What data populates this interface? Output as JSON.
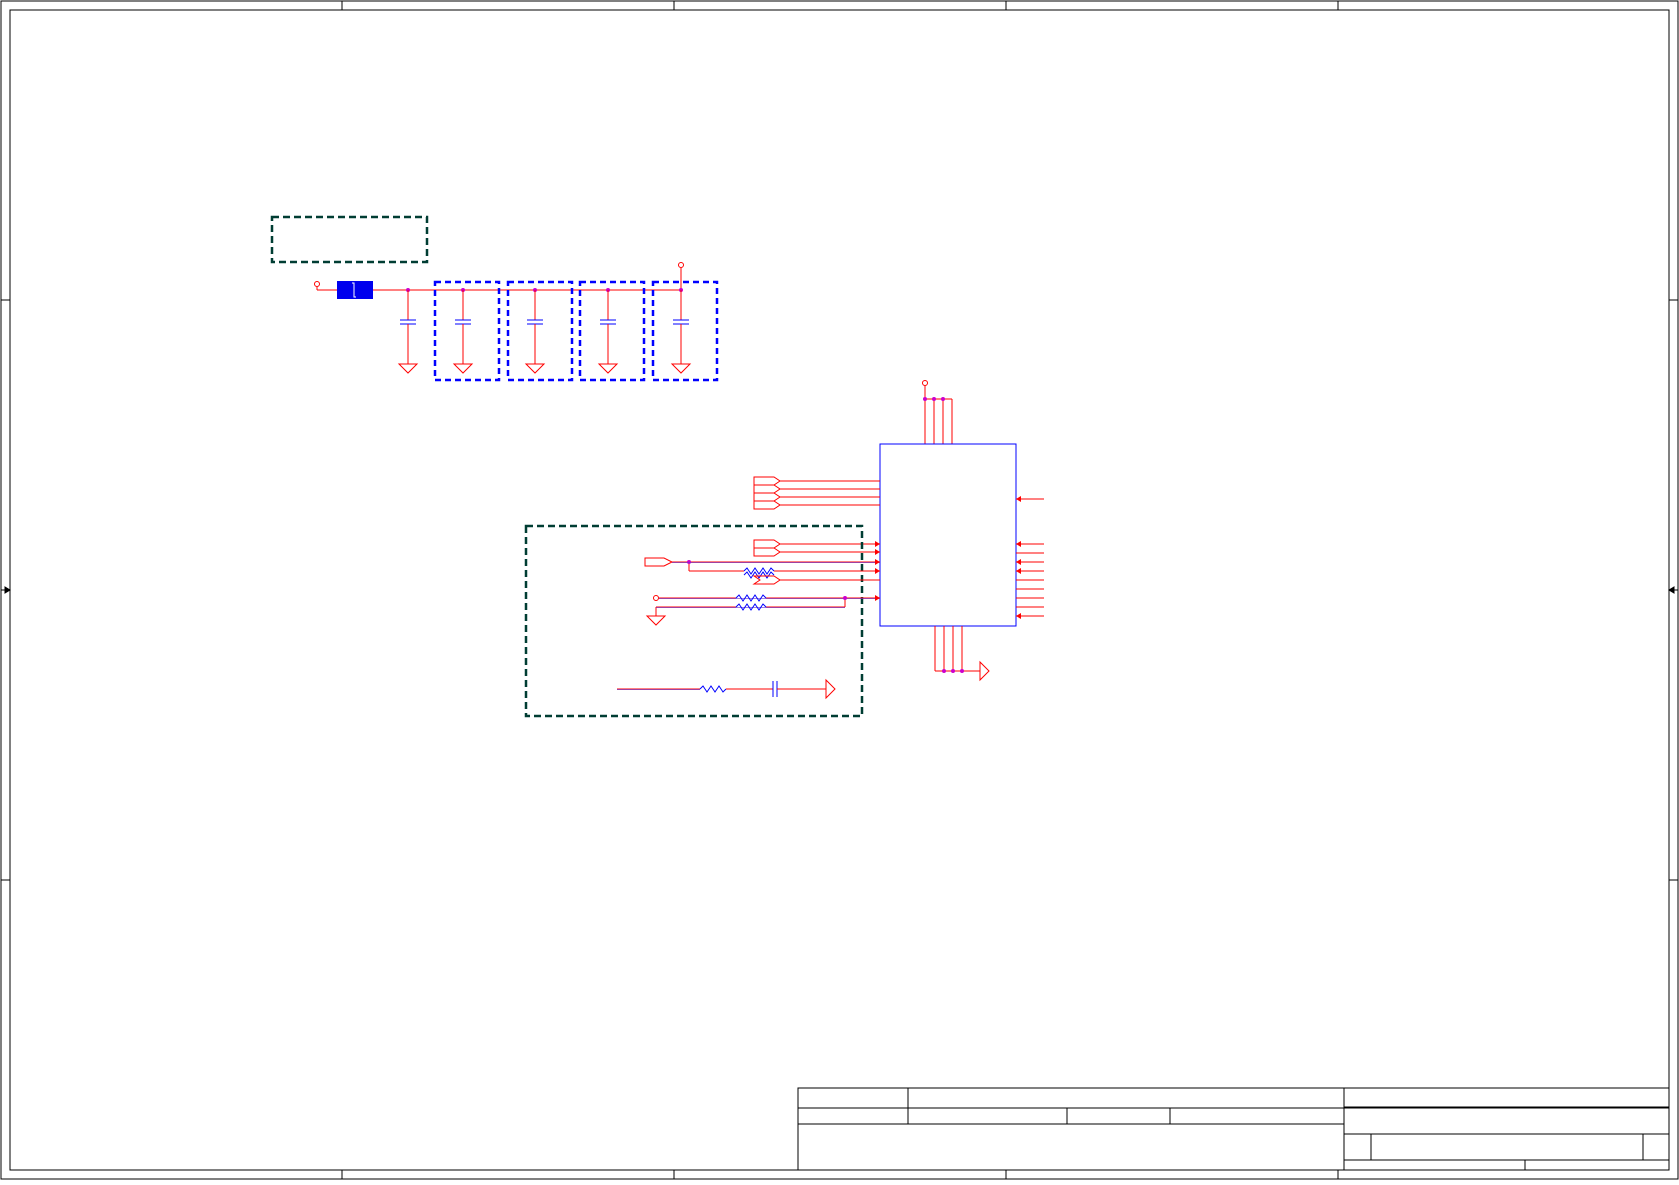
{
  "sheet": {
    "kind": "schematic-sheet",
    "title_block": {
      "title": "",
      "size": "",
      "document_number": "",
      "rev": "",
      "date": "",
      "sheet": "",
      "of": ""
    }
  },
  "colors": {
    "border": "#000000",
    "wire": "#ff0000",
    "component": "#0000ff",
    "junction": "#cc00cc",
    "group_box": "#003d33",
    "decap_box": "#0000ff",
    "ic_outline": "#0000ff"
  },
  "icons": {
    "ground": "ground-icon",
    "capacitor": "capacitor-icon",
    "resistor": "resistor-icon",
    "ferrite": "ferrite-bead-icon",
    "power_pin": "power-pin-icon",
    "net_port": "net-port-icon"
  }
}
